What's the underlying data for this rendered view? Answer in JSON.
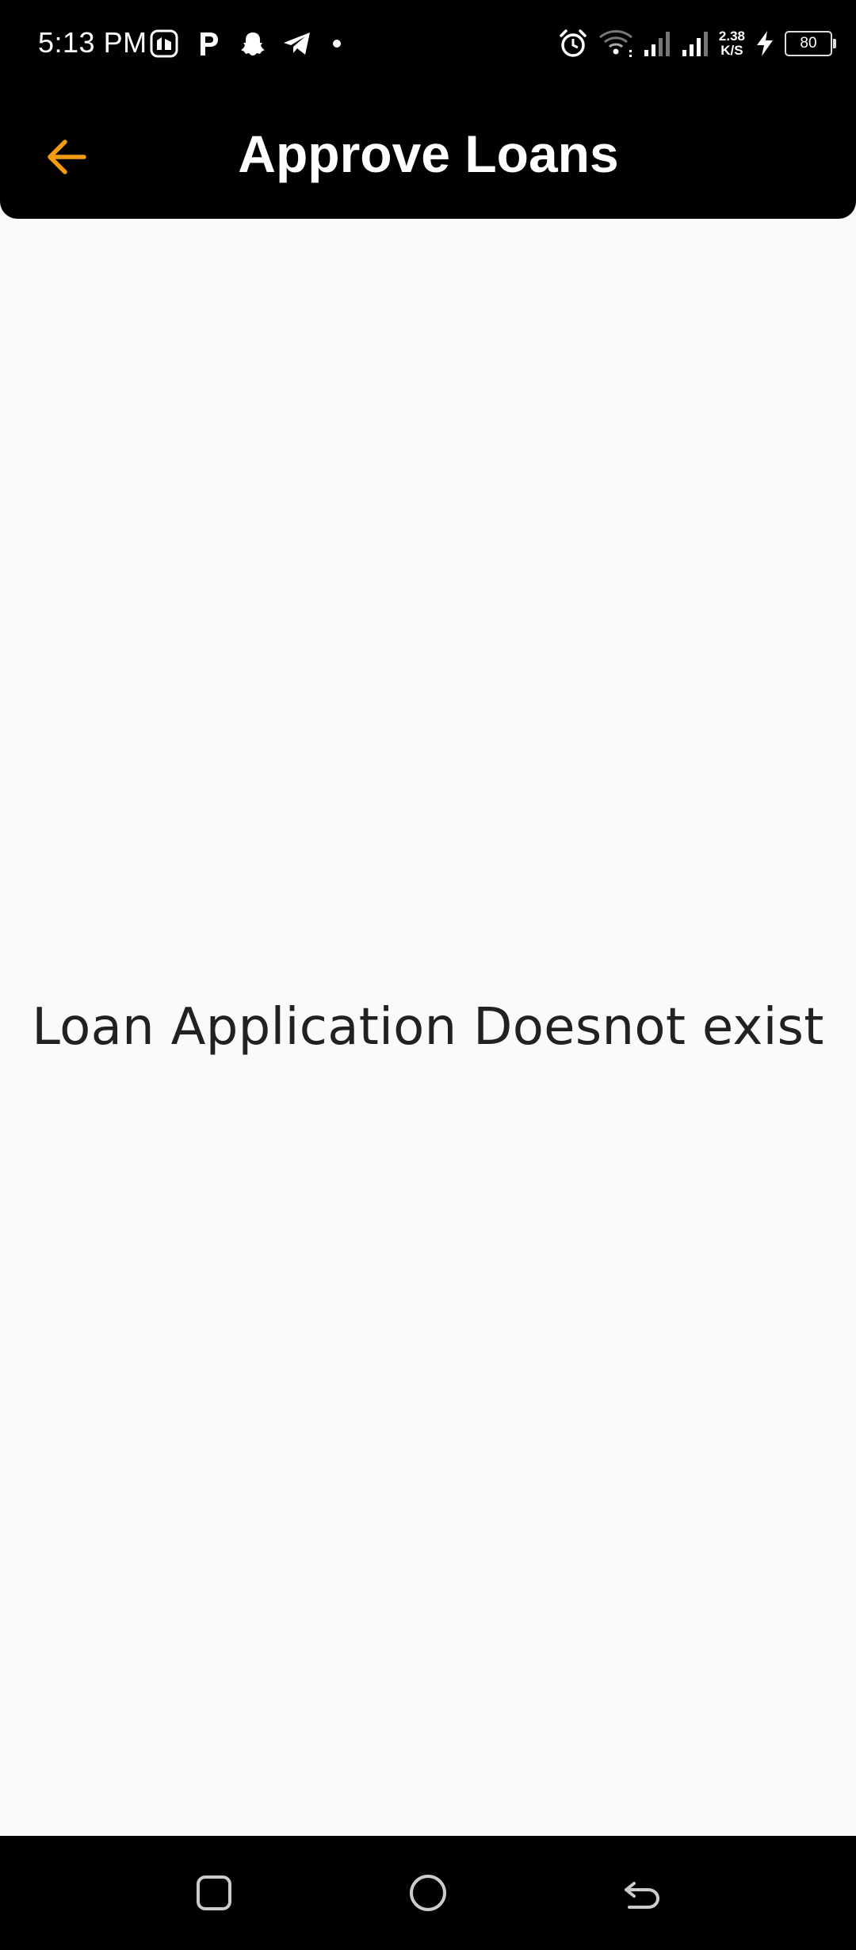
{
  "status_bar": {
    "time": "5:13 PM",
    "net_speed_value": "2.38",
    "net_speed_unit": "K/S",
    "battery_level": "80",
    "notification_icons": [
      "gallery-app-icon",
      "p-app-icon",
      "snapchat-icon",
      "telegram-icon",
      "more-dot-icon"
    ],
    "system_icons": [
      "alarm-icon",
      "wifi-icon",
      "signal-icon",
      "signal-icon",
      "charging-icon",
      "battery-icon"
    ]
  },
  "app_bar": {
    "title": "Approve Loans",
    "back_icon": "arrow-left-icon",
    "accent_color": "#F39C12",
    "background_color": "#000000"
  },
  "main": {
    "empty_message": "Loan Application Doesnot exist",
    "background_color": "#FAFAFA"
  },
  "nav_bar": {
    "buttons": [
      "recents-icon",
      "home-icon",
      "back-icon"
    ]
  }
}
